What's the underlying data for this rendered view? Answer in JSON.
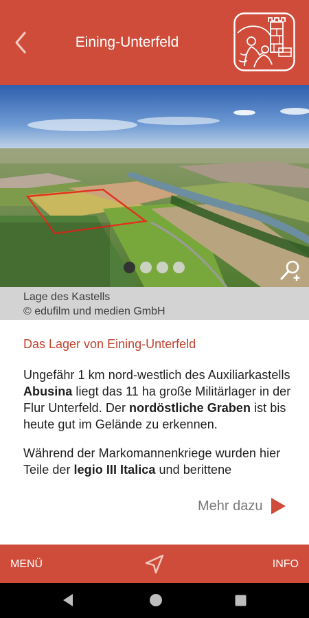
{
  "header": {
    "title": "Eining-Unterfeld",
    "background": "#cf4c3a"
  },
  "gallery": {
    "slides": 4,
    "active_slide": 1
  },
  "caption": {
    "line1": "Lage des Kastells",
    "line2": "© edufilm und medien GmbH"
  },
  "content": {
    "section_title": "Das Lager von Eining-Unterfeld",
    "para1": {
      "t1": "Ungefähr 1 km nord-westlich des Auxiliarkastells ",
      "b1": "Abusina",
      "t2": " liegt das 11 ha große Militärlager in der Flur Unterfeld. Der ",
      "b2": "nordöstliche Graben",
      "t3": " ist bis heute gut im Gelände zu erkennen."
    },
    "para2": {
      "t1": "Während der Markomannenkriege wurden hier Teile der ",
      "b1": "legio III Italica",
      "t2": " und berittene"
    },
    "more_label": "Mehr dazu"
  },
  "tabbar": {
    "menu_label": "MENÜ",
    "info_label": "INFO"
  },
  "colors": {
    "accent": "#cf4c3a",
    "section_title": "#c1422e",
    "caption_bg": "#d3d3d3"
  },
  "icons": [
    "chevron-left-icon",
    "castle-logo",
    "zoom-plus-icon",
    "navigation-arrow-icon",
    "triangle-right-icon"
  ]
}
